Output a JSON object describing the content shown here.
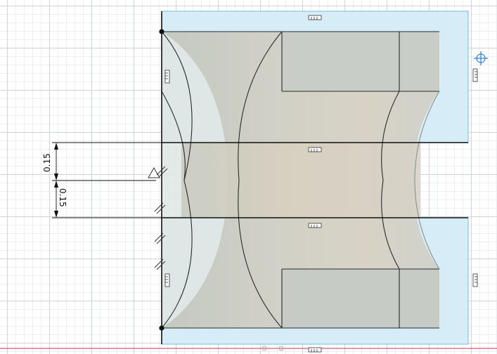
{
  "canvas": {
    "background": "#ffffff",
    "grid_major": "#cfd3d8",
    "grid_minor": "#eceef0",
    "sketch_profile_fill": "#cfe8f5",
    "sketch_profile_stroke": "#7fc4e4",
    "body_fill": "#c9cdc6",
    "body_highlight": "#ddd6c9",
    "origin_axis_color": "#d0305a"
  },
  "dimensions": [
    {
      "id": "dim-upper",
      "value": "0.15"
    },
    {
      "id": "dim-lower",
      "value": "0.15"
    }
  ],
  "icons": [
    "sketch-profile-icon",
    "midpoint-constraint-icon",
    "parallel-constraint-icon",
    "collinear-constraint-icon",
    "move-handle-icon",
    "sketch-point-icon"
  ]
}
